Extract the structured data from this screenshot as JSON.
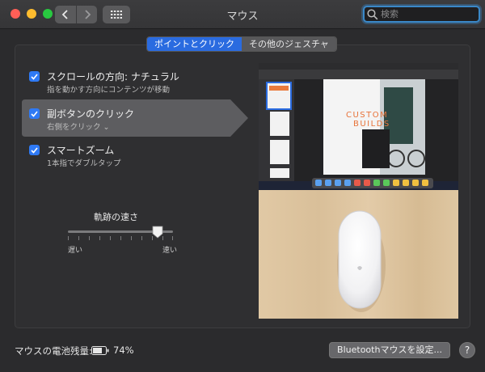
{
  "window": {
    "title": "マウス"
  },
  "search": {
    "placeholder": "検索"
  },
  "tabs": [
    {
      "label": "ポイントとクリック",
      "active": true
    },
    {
      "label": "その他のジェスチャ",
      "active": false
    }
  ],
  "options": [
    {
      "title": "スクロールの方向: ナチュラル",
      "subtitle": "指を動かす方向にコンテンツが移動",
      "checked": true
    },
    {
      "title": "副ボタンのクリック",
      "subtitle": "右側をクリック ⌄",
      "checked": true,
      "selected": true
    },
    {
      "title": "スマートズーム",
      "subtitle": "1本指でダブルタップ",
      "checked": true
    }
  ],
  "tracking": {
    "label": "軌跡の速さ",
    "slow": "遅い",
    "fast": "速い",
    "value": 0.85
  },
  "preview": {
    "magazine_title_1": "CUSTOM",
    "magazine_title_2": "BUILDS"
  },
  "footer": {
    "battery_label": "マウスの電池残量:",
    "battery_percent": "74%",
    "bluetooth_button": "Bluetoothマウスを設定...",
    "help": "?"
  },
  "colors": {
    "accent": "#2a6be0",
    "checkbox": "#2f7af5",
    "background": "#2b2b2d"
  }
}
